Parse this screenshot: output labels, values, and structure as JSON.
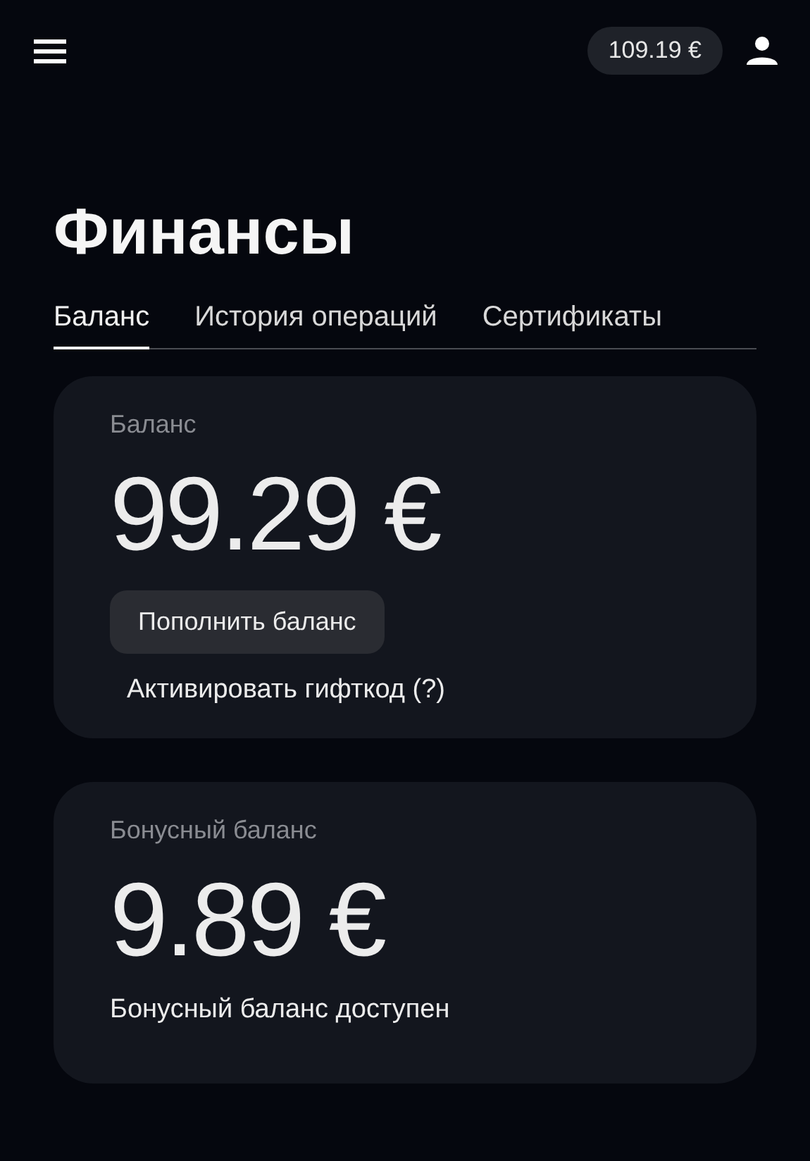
{
  "header": {
    "balance_badge": "109.19 €"
  },
  "title": "Финансы",
  "tabs": [
    {
      "label": "Баланс",
      "selected": true
    },
    {
      "label": "История операций",
      "selected": false
    },
    {
      "label": "Сертификаты",
      "selected": false
    }
  ],
  "cards": [
    {
      "kind": "actions",
      "label": "Баланс",
      "amount": "99.29 €",
      "button": "Пополнить баланс",
      "link": "Активировать гифткод (?)"
    },
    {
      "kind": "note",
      "label": "Бонусный баланс",
      "amount": "9.89 €",
      "note": "Бонусный баланс доступен"
    }
  ]
}
